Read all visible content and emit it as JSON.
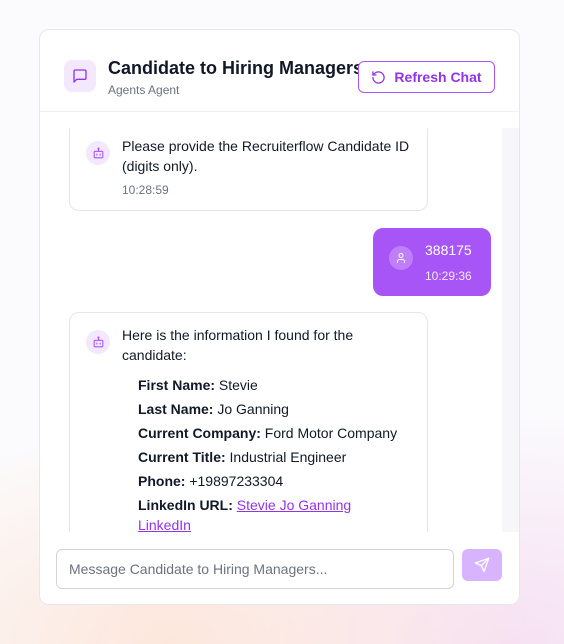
{
  "header": {
    "title": "Candidate to Hiring Managers",
    "subtitle": "Agents Agent",
    "refresh_label": "Refresh Chat",
    "chat_icon": "message-square-icon",
    "refresh_icon": "rotate-ccw-icon"
  },
  "messages": [
    {
      "role": "bot",
      "text": "Please provide the Recruiterflow Candidate ID (digits only).",
      "time": "10:28:59"
    },
    {
      "role": "user",
      "text": "388175",
      "time": "10:29:36"
    },
    {
      "role": "bot",
      "text": "Here is the information I found for the candidate:",
      "fields": [
        {
          "label": "First Name:",
          "value": "Stevie"
        },
        {
          "label": "Last Name:",
          "value": "Jo Ganning"
        },
        {
          "label": "Current Company:",
          "value": "Ford Motor Company"
        },
        {
          "label": "Current Title:",
          "value": "Industrial Engineer"
        },
        {
          "label": "Phone:",
          "value": "+19897233304"
        },
        {
          "label": "LinkedIn URL:",
          "link_text": "Stevie Jo Ganning LinkedIn"
        }
      ]
    }
  ],
  "composer": {
    "placeholder": "Message Candidate to Hiring Managers...",
    "value": "",
    "send_icon": "send-icon"
  },
  "colors": {
    "accent": "#a855f7",
    "accent_dark": "#9333ea",
    "accent_light": "#f3e8ff",
    "send_disabled": "#d8b4fe"
  }
}
